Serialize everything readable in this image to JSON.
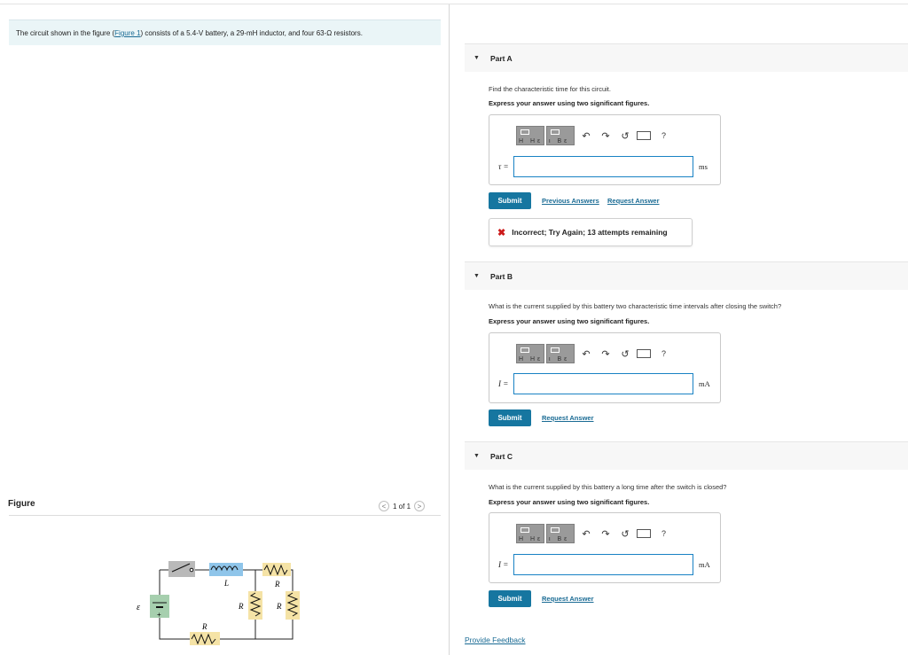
{
  "problem": {
    "text_before": "The circuit shown in the figure (",
    "figure_link": "Figure 1",
    "text_after": ") consists of a 5.4-V battery, a 29-mH inductor, and four 63-Ω resistors."
  },
  "figure": {
    "heading": "Figure",
    "pager": {
      "prev": "<",
      "count": "1 of 1",
      "next": ">"
    },
    "circuit_labels": {
      "emf": "ε",
      "plus": "+",
      "inductor": "L",
      "resistor": "R"
    }
  },
  "toolbar": {
    "templates_label": "H  Hε",
    "symbols_label": "ι  Bε",
    "undo": "↶",
    "redo": "↷",
    "reset": "↺",
    "help": "?"
  },
  "parts": [
    {
      "title": "Part A",
      "question": "Find the characteristic time for this circuit.",
      "instruction": "Express your answer using two significant figures.",
      "variable": "τ =",
      "value": "",
      "unit": "ms",
      "submit": "Submit",
      "links": [
        "Previous Answers",
        "Request Answer"
      ],
      "feedback": "Incorrect; Try Again; 13 attempts remaining"
    },
    {
      "title": "Part B",
      "question": "What is the current supplied by this battery two characteristic time intervals after closing the switch?",
      "instruction": "Express your answer using two significant figures.",
      "variable": "I =",
      "value": "",
      "unit": "mA",
      "submit": "Submit",
      "links": [
        "Request Answer"
      ]
    },
    {
      "title": "Part C",
      "question": "What is the current supplied by this battery a long time after the switch is closed?",
      "instruction": "Express your answer using two significant figures.",
      "variable": "I =",
      "value": "",
      "unit": "mA",
      "submit": "Submit",
      "links": [
        "Request Answer"
      ]
    }
  ],
  "provide_feedback": "Provide Feedback",
  "colors": {
    "accent": "#1676a0",
    "link": "#1a6b94",
    "error": "#cc1a1a",
    "problem_bg": "#eaf5f7"
  }
}
